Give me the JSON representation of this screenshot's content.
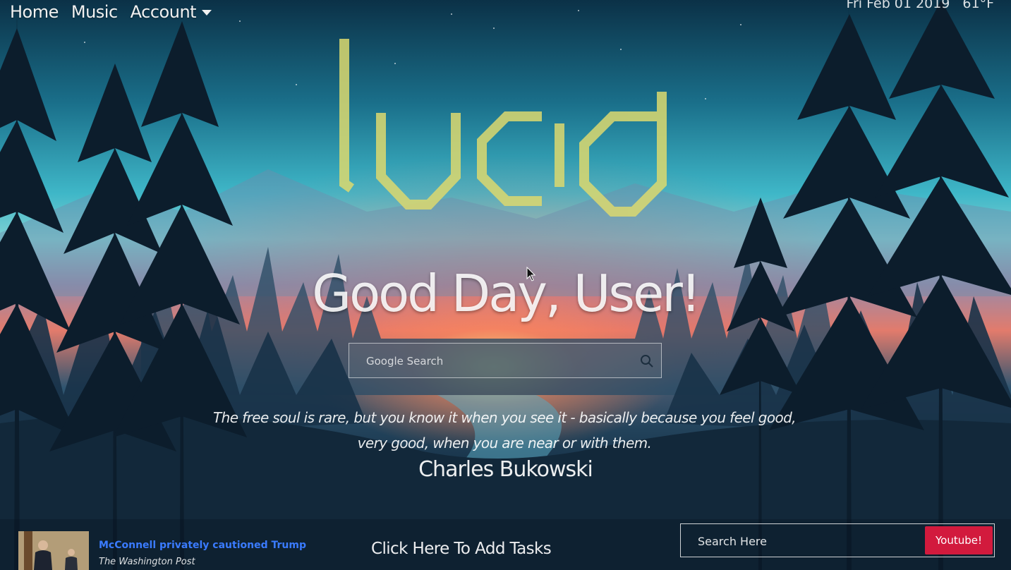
{
  "nav": {
    "items": [
      {
        "label": "Home"
      },
      {
        "label": "Music"
      },
      {
        "label": "Account"
      }
    ],
    "account_icon": "chevron-down-icon"
  },
  "status": {
    "date": "Fri Feb 01 2019",
    "temperature": "61°F"
  },
  "logo": {
    "text": "lucid",
    "color": "#dcd96f"
  },
  "greeting": "Good Day, User!",
  "google_search": {
    "placeholder": "Google Search",
    "icon": "search-icon"
  },
  "quote": {
    "line1": "The free soul is rare, but you know it when you see it - basically because you feel good,",
    "line2": "very good, when you are near or with them.",
    "author": "Charles Bukowski"
  },
  "news": {
    "title": "McConnell privately cautioned Trump",
    "source": "The Washington Post",
    "title_color": "#3a7bff"
  },
  "tasks": {
    "label": "Click Here To Add Tasks"
  },
  "youtube_search": {
    "placeholder": "Search Here",
    "button_label": "Youtube!",
    "button_color": "#d21a3d"
  }
}
